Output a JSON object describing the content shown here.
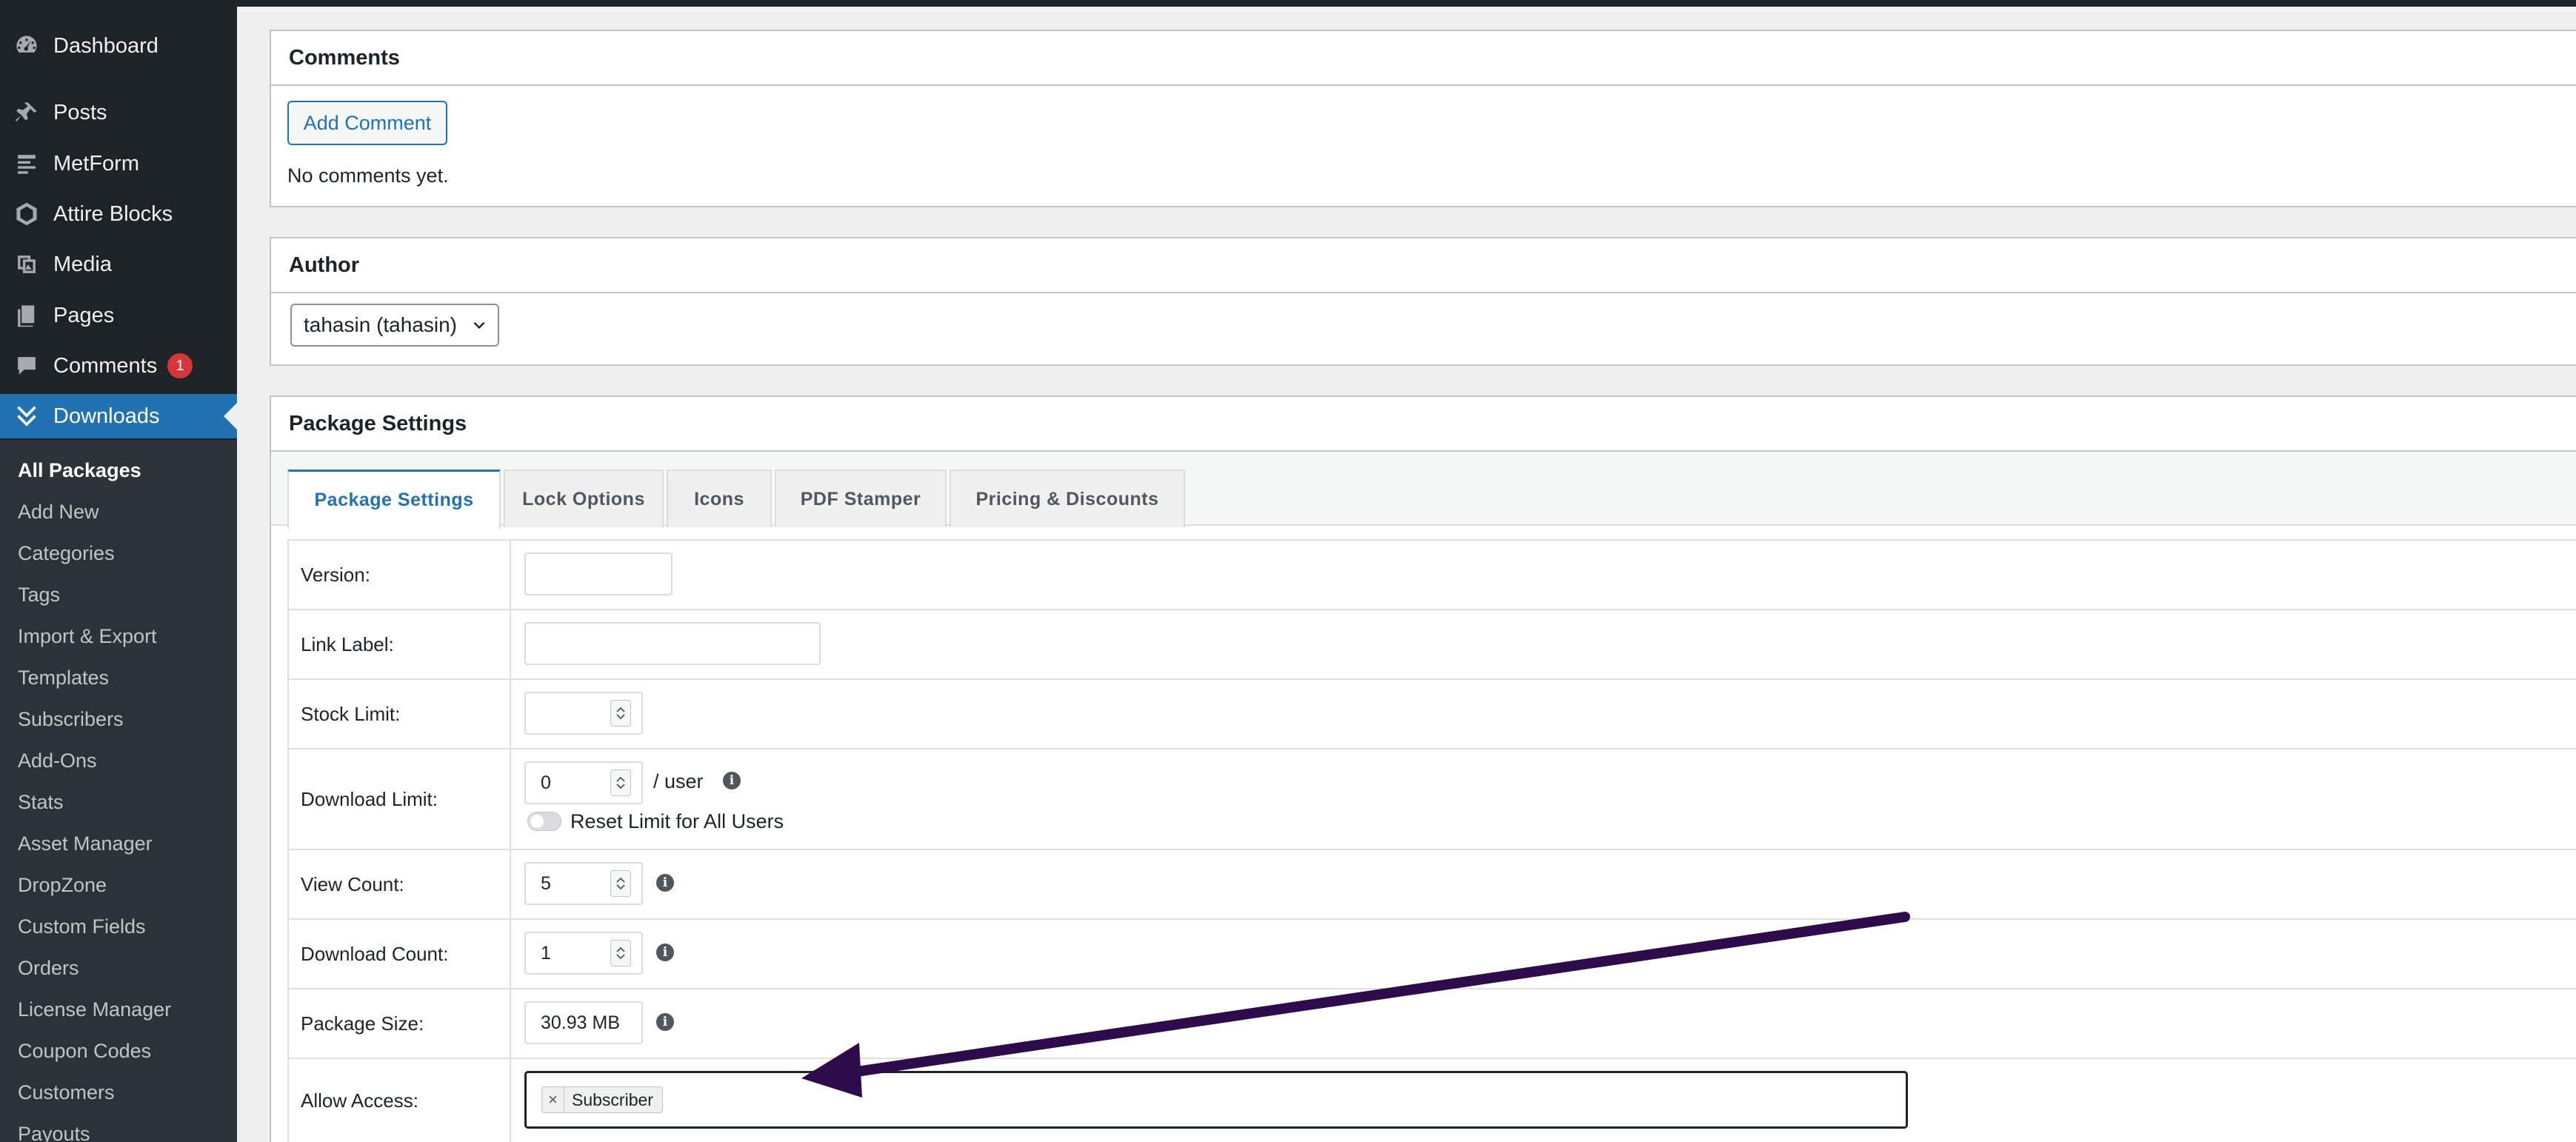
{
  "sidebar": {
    "menu": [
      {
        "label": "Dashboard",
        "icon": "dashboard-icon"
      },
      {
        "label": "Posts",
        "icon": "pin-icon"
      },
      {
        "label": "MetForm",
        "icon": "form-icon"
      },
      {
        "label": "Attire Blocks",
        "icon": "blocks-icon"
      },
      {
        "label": "Media",
        "icon": "media-icon"
      },
      {
        "label": "Pages",
        "icon": "pages-icon"
      },
      {
        "label": "Comments",
        "icon": "comment-icon",
        "badge": "1"
      },
      {
        "label": "Downloads",
        "icon": "download-icon"
      }
    ],
    "submenu": [
      "All Packages",
      "Add New",
      "Categories",
      "Tags",
      "Import & Export",
      "Templates",
      "Subscribers",
      "Add-Ons",
      "Stats",
      "Asset Manager",
      "DropZone",
      "Custom Fields",
      "Orders",
      "License Manager",
      "Coupon Codes",
      "Customers",
      "Payouts"
    ]
  },
  "comments_panel": {
    "title": "Comments",
    "add_button": "Add Comment",
    "empty_text": "No comments yet."
  },
  "author_panel": {
    "title": "Author",
    "selected": "tahasin (tahasin)"
  },
  "package_panel": {
    "title": "Package Settings",
    "tabs": [
      "Package Settings",
      "Lock Options",
      "Icons",
      "PDF Stamper",
      "Pricing & Discounts"
    ],
    "active_tab": "Package Settings",
    "rows": {
      "version": {
        "label": "Version:",
        "value": ""
      },
      "link_label": {
        "label": "Link Label:",
        "value": ""
      },
      "stock_limit": {
        "label": "Stock Limit:",
        "value": ""
      },
      "download_limit": {
        "label": "Download Limit:",
        "value": "0",
        "suffix": "/ user",
        "reset_label": "Reset Limit for All Users"
      },
      "view_count": {
        "label": "View Count:",
        "value": "5"
      },
      "download_count": {
        "label": "Download Count:",
        "value": "1"
      },
      "package_size": {
        "label": "Package Size:",
        "value": "30.93 MB"
      },
      "allow_access": {
        "label": "Allow Access:",
        "selected": [
          "Subscriber"
        ]
      }
    }
  },
  "colors": {
    "sidebar_bg": "#1d2327",
    "submenu_bg": "#2c3338",
    "accent": "#2271b1",
    "badge": "#d63638",
    "annotation_arrow": "#2e0b4a"
  }
}
